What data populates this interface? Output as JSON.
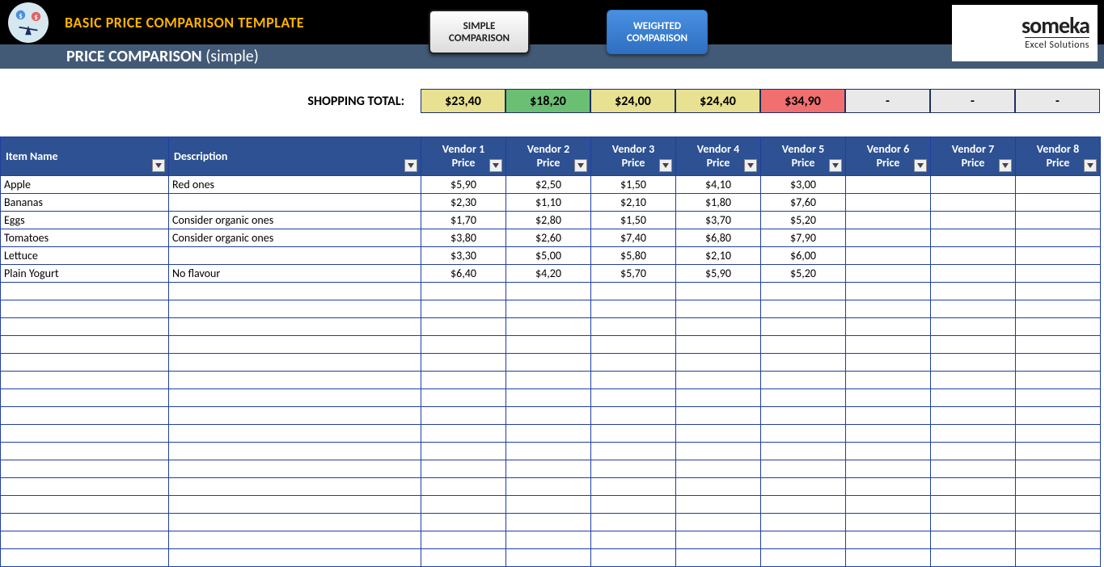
{
  "header": {
    "main_title": "BASIC PRICE COMPARISON TEMPLATE",
    "sub_title": "PRICE COMPARISON",
    "sub_suffix": "(simple)",
    "tab_simple_l1": "SIMPLE",
    "tab_simple_l2": "COMPARISON",
    "tab_weighted_l1": "WEIGHTED",
    "tab_weighted_l2": "COMPARISON",
    "logo_top": "someka",
    "logo_bottom": "Excel Solutions"
  },
  "totals": {
    "label": "SHOPPING TOTAL:",
    "cells": [
      {
        "value": "$23,40",
        "cls": "tot-yellow"
      },
      {
        "value": "$18,20",
        "cls": "tot-green"
      },
      {
        "value": "$24,00",
        "cls": "tot-yellow"
      },
      {
        "value": "$24,40",
        "cls": "tot-yellow"
      },
      {
        "value": "$34,90",
        "cls": "tot-red"
      },
      {
        "value": "-",
        "cls": "tot-empty"
      },
      {
        "value": "-",
        "cls": "tot-empty"
      },
      {
        "value": "-",
        "cls": "tot-empty"
      }
    ]
  },
  "columns": {
    "item": "Item Name",
    "desc": "Description",
    "vendors": [
      {
        "name": "Vendor 1",
        "sub": "Price"
      },
      {
        "name": "Vendor 2",
        "sub": "Price"
      },
      {
        "name": "Vendor 3",
        "sub": "Price"
      },
      {
        "name": "Vendor 4",
        "sub": "Price"
      },
      {
        "name": "Vendor 5",
        "sub": "Price"
      },
      {
        "name": "Vendor 6",
        "sub": "Price"
      },
      {
        "name": "Vendor 7",
        "sub": "Price"
      },
      {
        "name": "Vendor 8",
        "sub": "Price"
      }
    ]
  },
  "rows": [
    {
      "item": "Apple",
      "desc": "Red ones",
      "p": [
        "$5,90",
        "$2,50",
        "$1,50",
        "$4,10",
        "$3,00",
        "",
        "",
        ""
      ]
    },
    {
      "item": "Bananas",
      "desc": "",
      "p": [
        "$2,30",
        "$1,10",
        "$2,10",
        "$1,80",
        "$7,60",
        "",
        "",
        ""
      ]
    },
    {
      "item": "Eggs",
      "desc": "Consider organic ones",
      "p": [
        "$1,70",
        "$2,80",
        "$1,50",
        "$3,70",
        "$5,20",
        "",
        "",
        ""
      ]
    },
    {
      "item": "Tomatoes",
      "desc": "Consider organic ones",
      "p": [
        "$3,80",
        "$2,60",
        "$7,40",
        "$6,80",
        "$7,90",
        "",
        "",
        ""
      ]
    },
    {
      "item": "Lettuce",
      "desc": "",
      "p": [
        "$3,30",
        "$5,00",
        "$5,80",
        "$2,10",
        "$6,00",
        "",
        "",
        ""
      ]
    },
    {
      "item": "Plain Yogurt",
      "desc": "No flavour",
      "p": [
        "$6,40",
        "$4,20",
        "$5,70",
        "$5,90",
        "$5,20",
        "",
        "",
        ""
      ]
    }
  ],
  "empty_rows": 16
}
